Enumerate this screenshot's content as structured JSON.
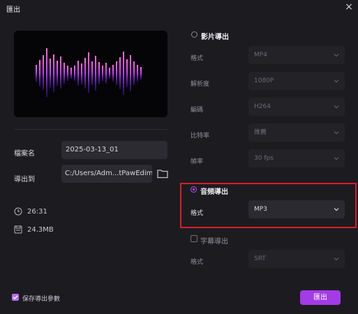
{
  "window": {
    "title": "匯出"
  },
  "left": {
    "filename_label": "檔案名",
    "filename_value": "2025-03-13_01",
    "exportto_label": "導出到",
    "exportto_value": "C:/Users/Adm...tPawEdimakor",
    "duration": "26:31",
    "size": "24.3MB"
  },
  "right": {
    "video_export": {
      "title": "影片導出",
      "rows": [
        {
          "label": "格式",
          "value": "MP4"
        },
        {
          "label": "解析度",
          "value": "1080P"
        },
        {
          "label": "編碼",
          "value": "H264"
        },
        {
          "label": "比特率",
          "value": "推薦"
        },
        {
          "label": "幀率",
          "value": "30  fps"
        }
      ]
    },
    "audio_export": {
      "title": "音頻導出",
      "format_label": "格式",
      "format_value": "MP3"
    },
    "subtitle_export": {
      "title": "字幕導出",
      "format_label": "格式",
      "format_value": "SRT"
    }
  },
  "footer": {
    "save_params": "保存導出參數",
    "export_button": "匯出"
  },
  "icons": {
    "folder": "folder-icon",
    "clock": "clock-icon",
    "disk": "save-icon",
    "close": "close-icon",
    "chevron": "chevron-down-icon"
  },
  "colors": {
    "accent": "#c24dff",
    "button": "#a33be6",
    "highlight": "#d5202a"
  }
}
